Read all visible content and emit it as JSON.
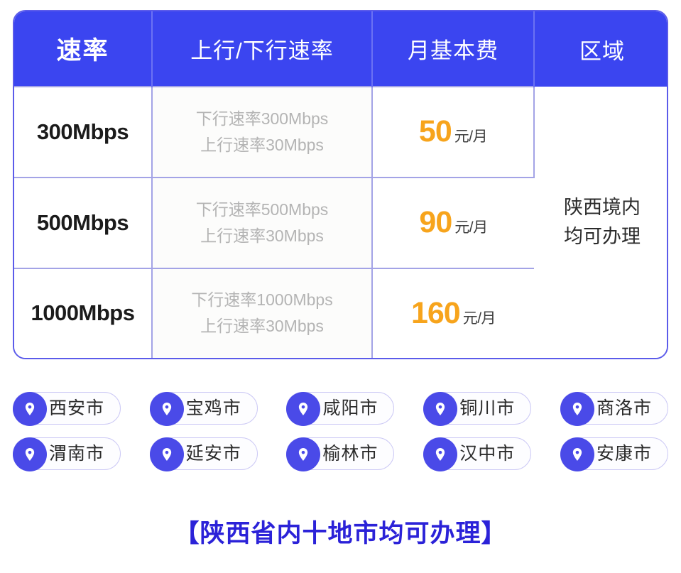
{
  "table": {
    "headers": [
      {
        "label": "速率",
        "emphasis": true
      },
      {
        "label": "上行/下行速率",
        "emphasis": false
      },
      {
        "label": "月基本费",
        "emphasis": false
      },
      {
        "label": "区域",
        "emphasis": false
      }
    ],
    "rows": [
      {
        "speed": "300Mbps",
        "detail_down": "下行速率300Mbps",
        "detail_up": "上行速率30Mbps",
        "price_value": "50",
        "price_unit": "元/月"
      },
      {
        "speed": "500Mbps",
        "detail_down": "下行速率500Mbps",
        "detail_up": "上行速率30Mbps",
        "price_value": "90",
        "price_unit": "元/月"
      },
      {
        "speed": "1000Mbps",
        "detail_down": "下行速率1000Mbps",
        "detail_up": "上行速率30Mbps",
        "price_value": "160",
        "price_unit": "元/月"
      }
    ],
    "region_cell": {
      "line1": "陕西境内",
      "line2": "均可办理"
    }
  },
  "cities": {
    "icon": "location-pin-icon",
    "row1": [
      {
        "name": "西安市"
      },
      {
        "name": "宝鸡市"
      },
      {
        "name": "咸阳市"
      },
      {
        "name": "铜川市"
      },
      {
        "name": "商洛市"
      }
    ],
    "row2": [
      {
        "name": "渭南市"
      },
      {
        "name": "延安市"
      },
      {
        "name": "榆林市"
      },
      {
        "name": "汉中市"
      },
      {
        "name": "安康市"
      }
    ]
  },
  "footer": {
    "note": "【陕西省内十地市均可办理】"
  },
  "colors": {
    "header_blue": "#3b45f0",
    "border_blue": "#5b5bea",
    "grid_line": "#a3a3e6",
    "price_orange": "#f7a41c",
    "pin_blue": "#4a4ae8",
    "footer_blue": "#2b22d8",
    "detail_gray": "#b4b4b4"
  }
}
